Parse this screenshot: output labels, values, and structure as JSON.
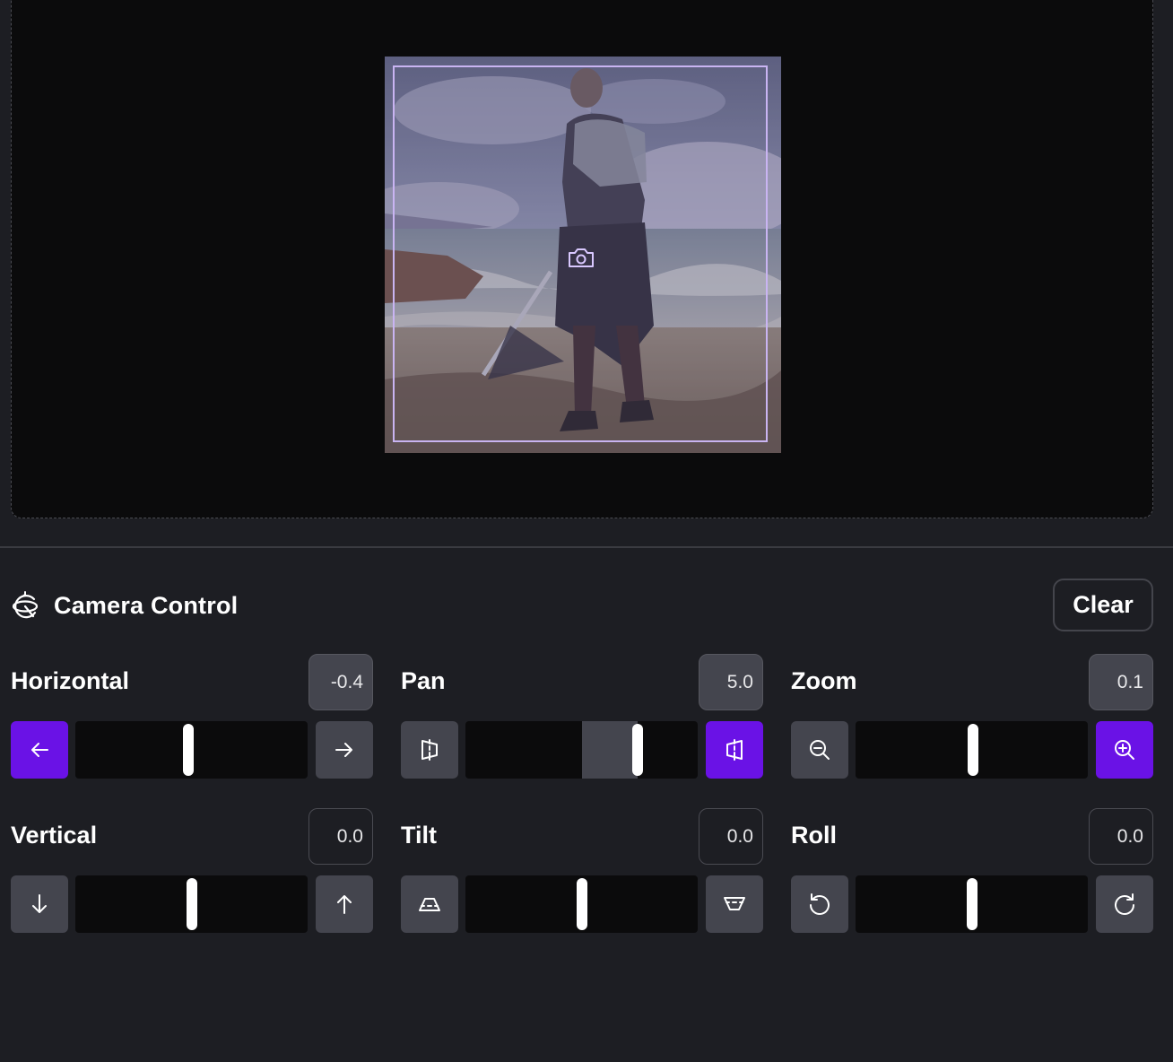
{
  "preview": {
    "image_alt": "Armored warrior standing on a beach looking out at the sea",
    "frame_icon": "camera-icon"
  },
  "header": {
    "icon": "camera-orbit-icon",
    "title": "Camera Control",
    "clear_label": "Clear"
  },
  "colors": {
    "accent": "#6a12e6",
    "frame": "#c9b4f2",
    "button": "#44454e",
    "track": "#0b0b0c",
    "panel": "#1d1e23"
  },
  "controls": [
    {
      "id": "horizontal",
      "label": "Horizontal",
      "value": "-0.4",
      "level": 0.485,
      "fill": false,
      "filled_box": true,
      "left_icon": "arrow-left-icon",
      "right_icon": "arrow-right-icon",
      "active": "left"
    },
    {
      "id": "pan",
      "label": "Pan",
      "value": "5.0",
      "level": 0.74,
      "fill": true,
      "filled_box": true,
      "left_icon": "pan-left-icon",
      "right_icon": "pan-right-icon",
      "active": "right"
    },
    {
      "id": "zoom",
      "label": "Zoom",
      "value": "0.1",
      "level": 0.505,
      "fill": false,
      "filled_box": true,
      "left_icon": "zoom-out-icon",
      "right_icon": "zoom-in-icon",
      "active": "right"
    },
    {
      "id": "vertical",
      "label": "Vertical",
      "value": "0.0",
      "level": 0.5,
      "fill": false,
      "filled_box": false,
      "left_icon": "arrow-down-icon",
      "right_icon": "arrow-up-icon",
      "active": ""
    },
    {
      "id": "tilt",
      "label": "Tilt",
      "value": "0.0",
      "level": 0.5,
      "fill": false,
      "filled_box": false,
      "left_icon": "tilt-down-icon",
      "right_icon": "tilt-up-icon",
      "active": ""
    },
    {
      "id": "roll",
      "label": "Roll",
      "value": "0.0",
      "level": 0.5,
      "fill": false,
      "filled_box": false,
      "left_icon": "rotate-ccw-icon",
      "right_icon": "rotate-cw-icon",
      "active": ""
    }
  ]
}
